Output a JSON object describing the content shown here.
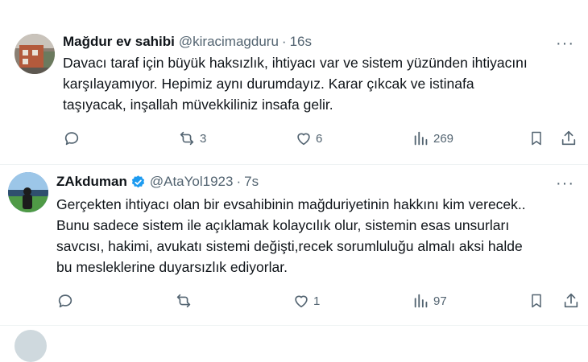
{
  "tweets": [
    {
      "name": "Mağdur ev sahibi",
      "handle": "@kiracimagduru",
      "separator": "·",
      "time": "16s",
      "more": "···",
      "body_lines": [
        "Davacı taraf için büyük haksızlık, ihtiyacı var ve sistem yüzünden ihtiyacını",
        "karşılayamıyor. Hepimiz aynı durumdayız. Karar çıkcak ve istinafa",
        "taşıyacak, inşallah müvekkiliniz insafa gelir."
      ],
      "retweets": "3",
      "likes": "6",
      "views": "269",
      "verified": false
    },
    {
      "name": "ZAkduman",
      "handle": "@AtaYol1923",
      "separator": "·",
      "time": "7s",
      "more": "···",
      "body_lines": [
        "Gerçekten ihtiyacı olan bir evsahibinin mağduriyetinin hakkını kim verecek..",
        "Bunu sadece sistem ile açıklamak kolaycılık olur, sistemin esas unsurları",
        "savcısı, hakimi, avukatı sistemi değişti,recek sorumluluğu almalı aksi halde",
        "bu mesleklerine duyarsızlık ediyorlar."
      ],
      "retweets": "",
      "likes": "1",
      "views": "97",
      "verified": true
    }
  ],
  "icons": {
    "reply": "reply-icon",
    "retweet": "retweet-icon",
    "like": "heart-icon",
    "views": "views-icon",
    "bookmark": "bookmark-icon",
    "share": "share-icon",
    "verified": "verified-badge-icon"
  },
  "colors": {
    "text": "#0f1419",
    "secondary": "#536471",
    "verified": "#1d9bf0",
    "divider": "#eff3f4"
  }
}
